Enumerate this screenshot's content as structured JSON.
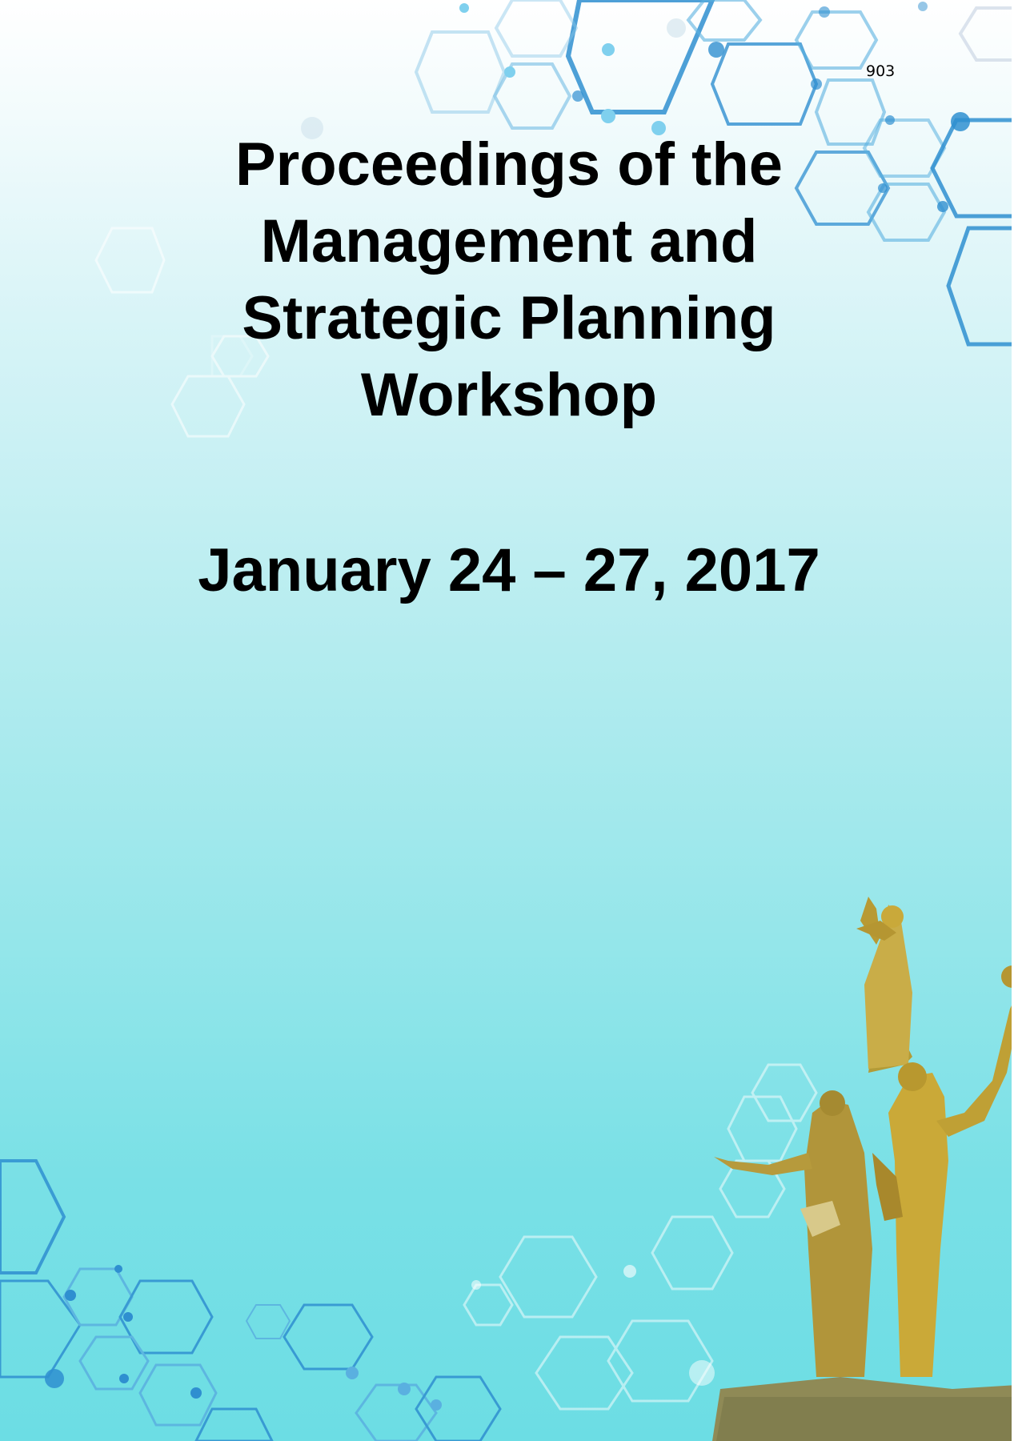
{
  "page": {
    "number": "903",
    "title_lines": [
      "Proceedings of the",
      "Management and",
      "Strategic Planning",
      "Workshop"
    ],
    "date": "January 24 – 27, 2017"
  },
  "decorations": {
    "hexagon_network": "molecular hexagon pattern",
    "monument": "golden statue monument",
    "colors": {
      "hex_blue": "#2f8fd0",
      "hex_light": "#7fd0ee",
      "statue_gold": "#c9a93a"
    }
  }
}
